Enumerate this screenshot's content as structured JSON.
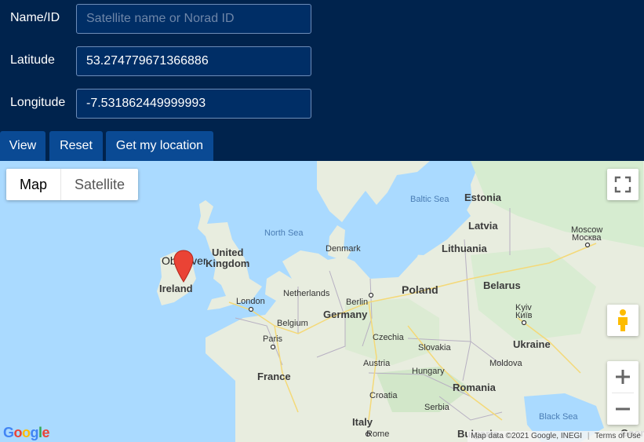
{
  "form": {
    "name_label": "Name/ID",
    "name_placeholder": "Satellite name or Norad ID",
    "name_value": "",
    "lat_label": "Latitude",
    "lat_value": "53.274779671366886",
    "lon_label": "Longitude",
    "lon_value": "-7.531862449999993"
  },
  "buttons": {
    "view": "View",
    "reset": "Reset",
    "locate": "Get my location"
  },
  "map": {
    "type_map": "Map",
    "type_satellite": "Satellite",
    "marker_label": "Observer",
    "attribution_data": "Map data ©2021 Google, INEGI",
    "attribution_terms": "Terms of Use",
    "logo": [
      "G",
      "o",
      "o",
      "g",
      "l",
      "e"
    ],
    "labels": {
      "baltic_sea": "Baltic Sea",
      "north_sea": "North Sea",
      "black_sea": "Black Sea",
      "estonia": "Estonia",
      "latvia": "Latvia",
      "lithuania": "Lithuania",
      "denmark": "Denmark",
      "united": "United",
      "kingdom": "Kingdom",
      "ireland": "Ireland",
      "netherlands": "Netherlands",
      "london": "London",
      "belgium": "Belgium",
      "berlin": "Berlin",
      "poland": "Poland",
      "germany": "Germany",
      "belarus": "Belarus",
      "moscow": "Moscow",
      "moscow_ru": "Москва",
      "paris": "Paris",
      "czechia": "Czechia",
      "slovakia": "Slovakia",
      "ukraine": "Ukraine",
      "kyiv": "Kyiv",
      "kyiv_ua": "Київ",
      "france": "France",
      "austria": "Austria",
      "hungary": "Hungary",
      "moldova": "Moldova",
      "romania": "Romania",
      "croatia": "Croatia",
      "serbia": "Serbia",
      "italy": "Italy",
      "rome": "Rome",
      "bulgaria": "Bulgaria",
      "georgia_partial": "Geor"
    }
  },
  "colors": {
    "header_bg": "#00234d",
    "button_bg": "#0a4a94",
    "input_bg": "#002e66",
    "water": "#aadaff",
    "land": "#e8eddf",
    "forest": "#cde8c4",
    "marker": "#ea4335"
  },
  "icons": [
    "fullscreen-icon",
    "pegman-icon",
    "zoom-in-icon",
    "zoom-out-icon",
    "map-marker-icon"
  ]
}
